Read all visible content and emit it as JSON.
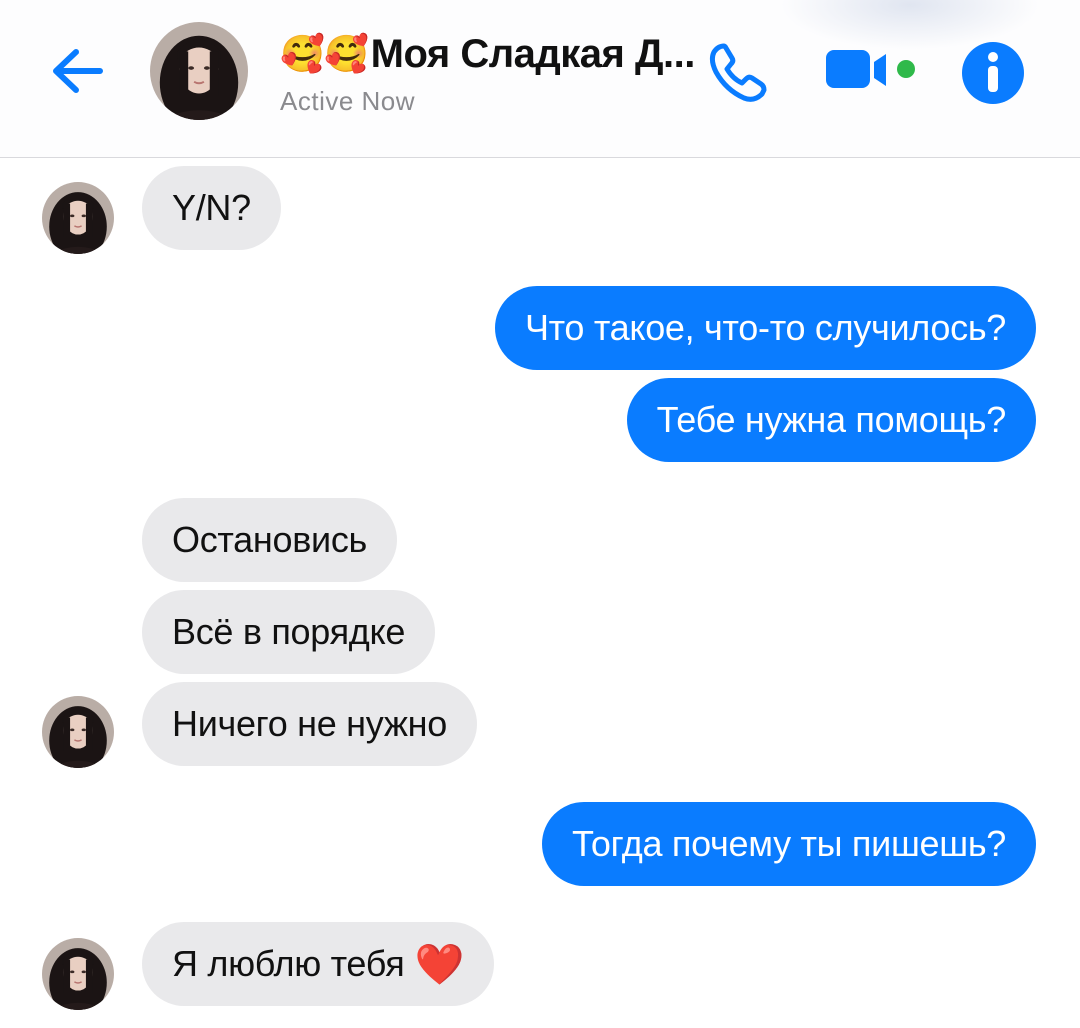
{
  "header": {
    "title_emoji": "🥰🥰",
    "title": "Моя Сладкая Д...",
    "status": "Active Now"
  },
  "messages": [
    {
      "from": "them",
      "text": "Y/N?"
    },
    {
      "from": "me",
      "text": "Что такое, что-то случилось?"
    },
    {
      "from": "me",
      "text": "Тебе нужна помощь?"
    },
    {
      "from": "them",
      "text": "Остановись"
    },
    {
      "from": "them",
      "text": "Всё в порядке"
    },
    {
      "from": "them",
      "text": "Ничего не нужно"
    },
    {
      "from": "me",
      "text": "Тогда почему ты пишешь?"
    },
    {
      "from": "them",
      "text": "Я люблю тебя",
      "emoji": "❤️"
    }
  ],
  "icons": [
    "back-arrow-icon",
    "phone-icon",
    "video-camera-icon",
    "info-icon",
    "heart-emoji-icon"
  ],
  "colors": {
    "accent": "#0a7cff",
    "incoming_bubble": "#e9e9eb",
    "online_dot": "#2fb94a",
    "status_text": "#8a8a8e"
  }
}
